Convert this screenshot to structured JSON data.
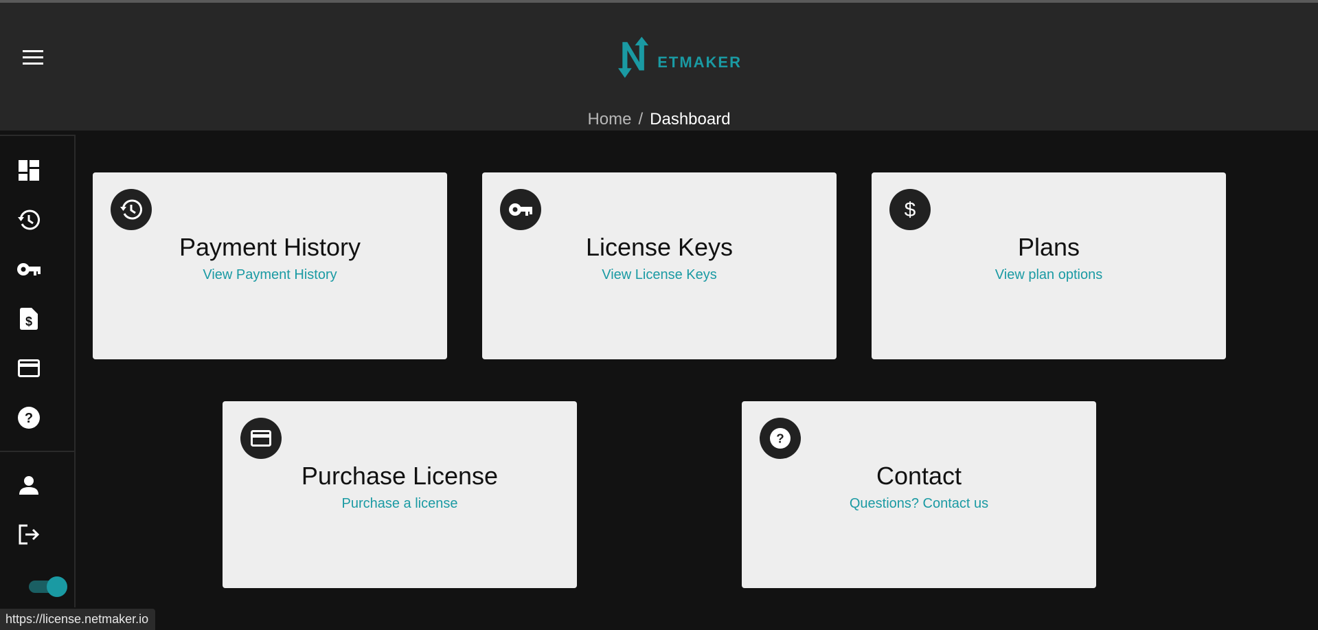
{
  "header": {
    "logo_text": "ETMAKER",
    "breadcrumb": {
      "home": "Home",
      "separator": "/",
      "current": "Dashboard"
    },
    "menu_icon": "hamburger-menu-icon"
  },
  "sidebar": {
    "items": [
      {
        "name": "dashboard",
        "icon": "dashboard-icon"
      },
      {
        "name": "payment-history",
        "icon": "history-icon"
      },
      {
        "name": "license-keys",
        "icon": "key-icon"
      },
      {
        "name": "plans",
        "icon": "invoice-dollar-icon"
      },
      {
        "name": "purchase-license",
        "icon": "credit-card-icon"
      },
      {
        "name": "contact",
        "icon": "help-icon"
      },
      {
        "name": "account",
        "icon": "person-icon"
      },
      {
        "name": "logout",
        "icon": "logout-icon"
      }
    ],
    "theme_toggle_on": true
  },
  "cards": [
    {
      "title": "Payment History",
      "link": "View Payment History",
      "icon": "history-icon"
    },
    {
      "title": "License Keys",
      "link": "View License Keys",
      "icon": "key-icon"
    },
    {
      "title": "Plans",
      "link": "View plan options",
      "icon": "dollar-icon"
    },
    {
      "title": "Purchase License",
      "link": "Purchase a license",
      "icon": "credit-card-icon"
    },
    {
      "title": "Contact",
      "link": "Questions? Contact us",
      "icon": "help-icon"
    }
  ],
  "status_url": "https://license.netmaker.io",
  "colors": {
    "accent": "#1a9aa3",
    "header_bg": "#272727",
    "page_bg": "#121212",
    "card_bg": "#eeeeee"
  }
}
